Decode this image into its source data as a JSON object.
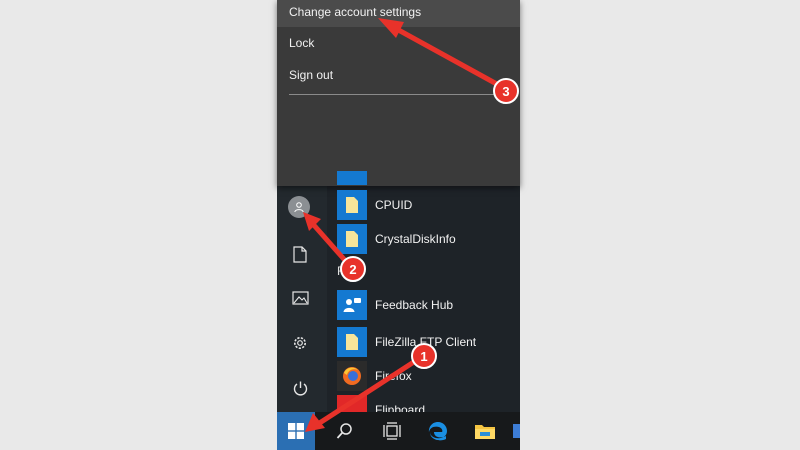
{
  "flyout": {
    "items": [
      {
        "label": "Change account settings"
      },
      {
        "label": "Lock"
      },
      {
        "label": "Sign out"
      }
    ]
  },
  "rail": {
    "icons": [
      "user-avatar-icon",
      "document-icon",
      "pictures-icon",
      "settings-gear-icon",
      "power-icon"
    ]
  },
  "apps": {
    "section_letter": "F",
    "items": [
      {
        "label": "CPUID",
        "icon": "folder-icon"
      },
      {
        "label": "CrystalDiskInfo",
        "icon": "folder-icon"
      },
      {
        "label": "Feedback Hub",
        "icon": "feedback-hub-icon"
      },
      {
        "label": "FileZilla FTP Client",
        "icon": "folder-icon"
      },
      {
        "label": "Firefox",
        "icon": "firefox-icon"
      },
      {
        "label": "Flipboard",
        "icon": "flipboard-icon"
      }
    ]
  },
  "taskbar": {
    "icons": [
      "windows-start-icon",
      "search-icon",
      "task-view-icon",
      "edge-icon",
      "file-explorer-icon"
    ]
  },
  "annotations": {
    "badges": [
      "1",
      "2",
      "3"
    ],
    "accent": "#e8322a"
  }
}
